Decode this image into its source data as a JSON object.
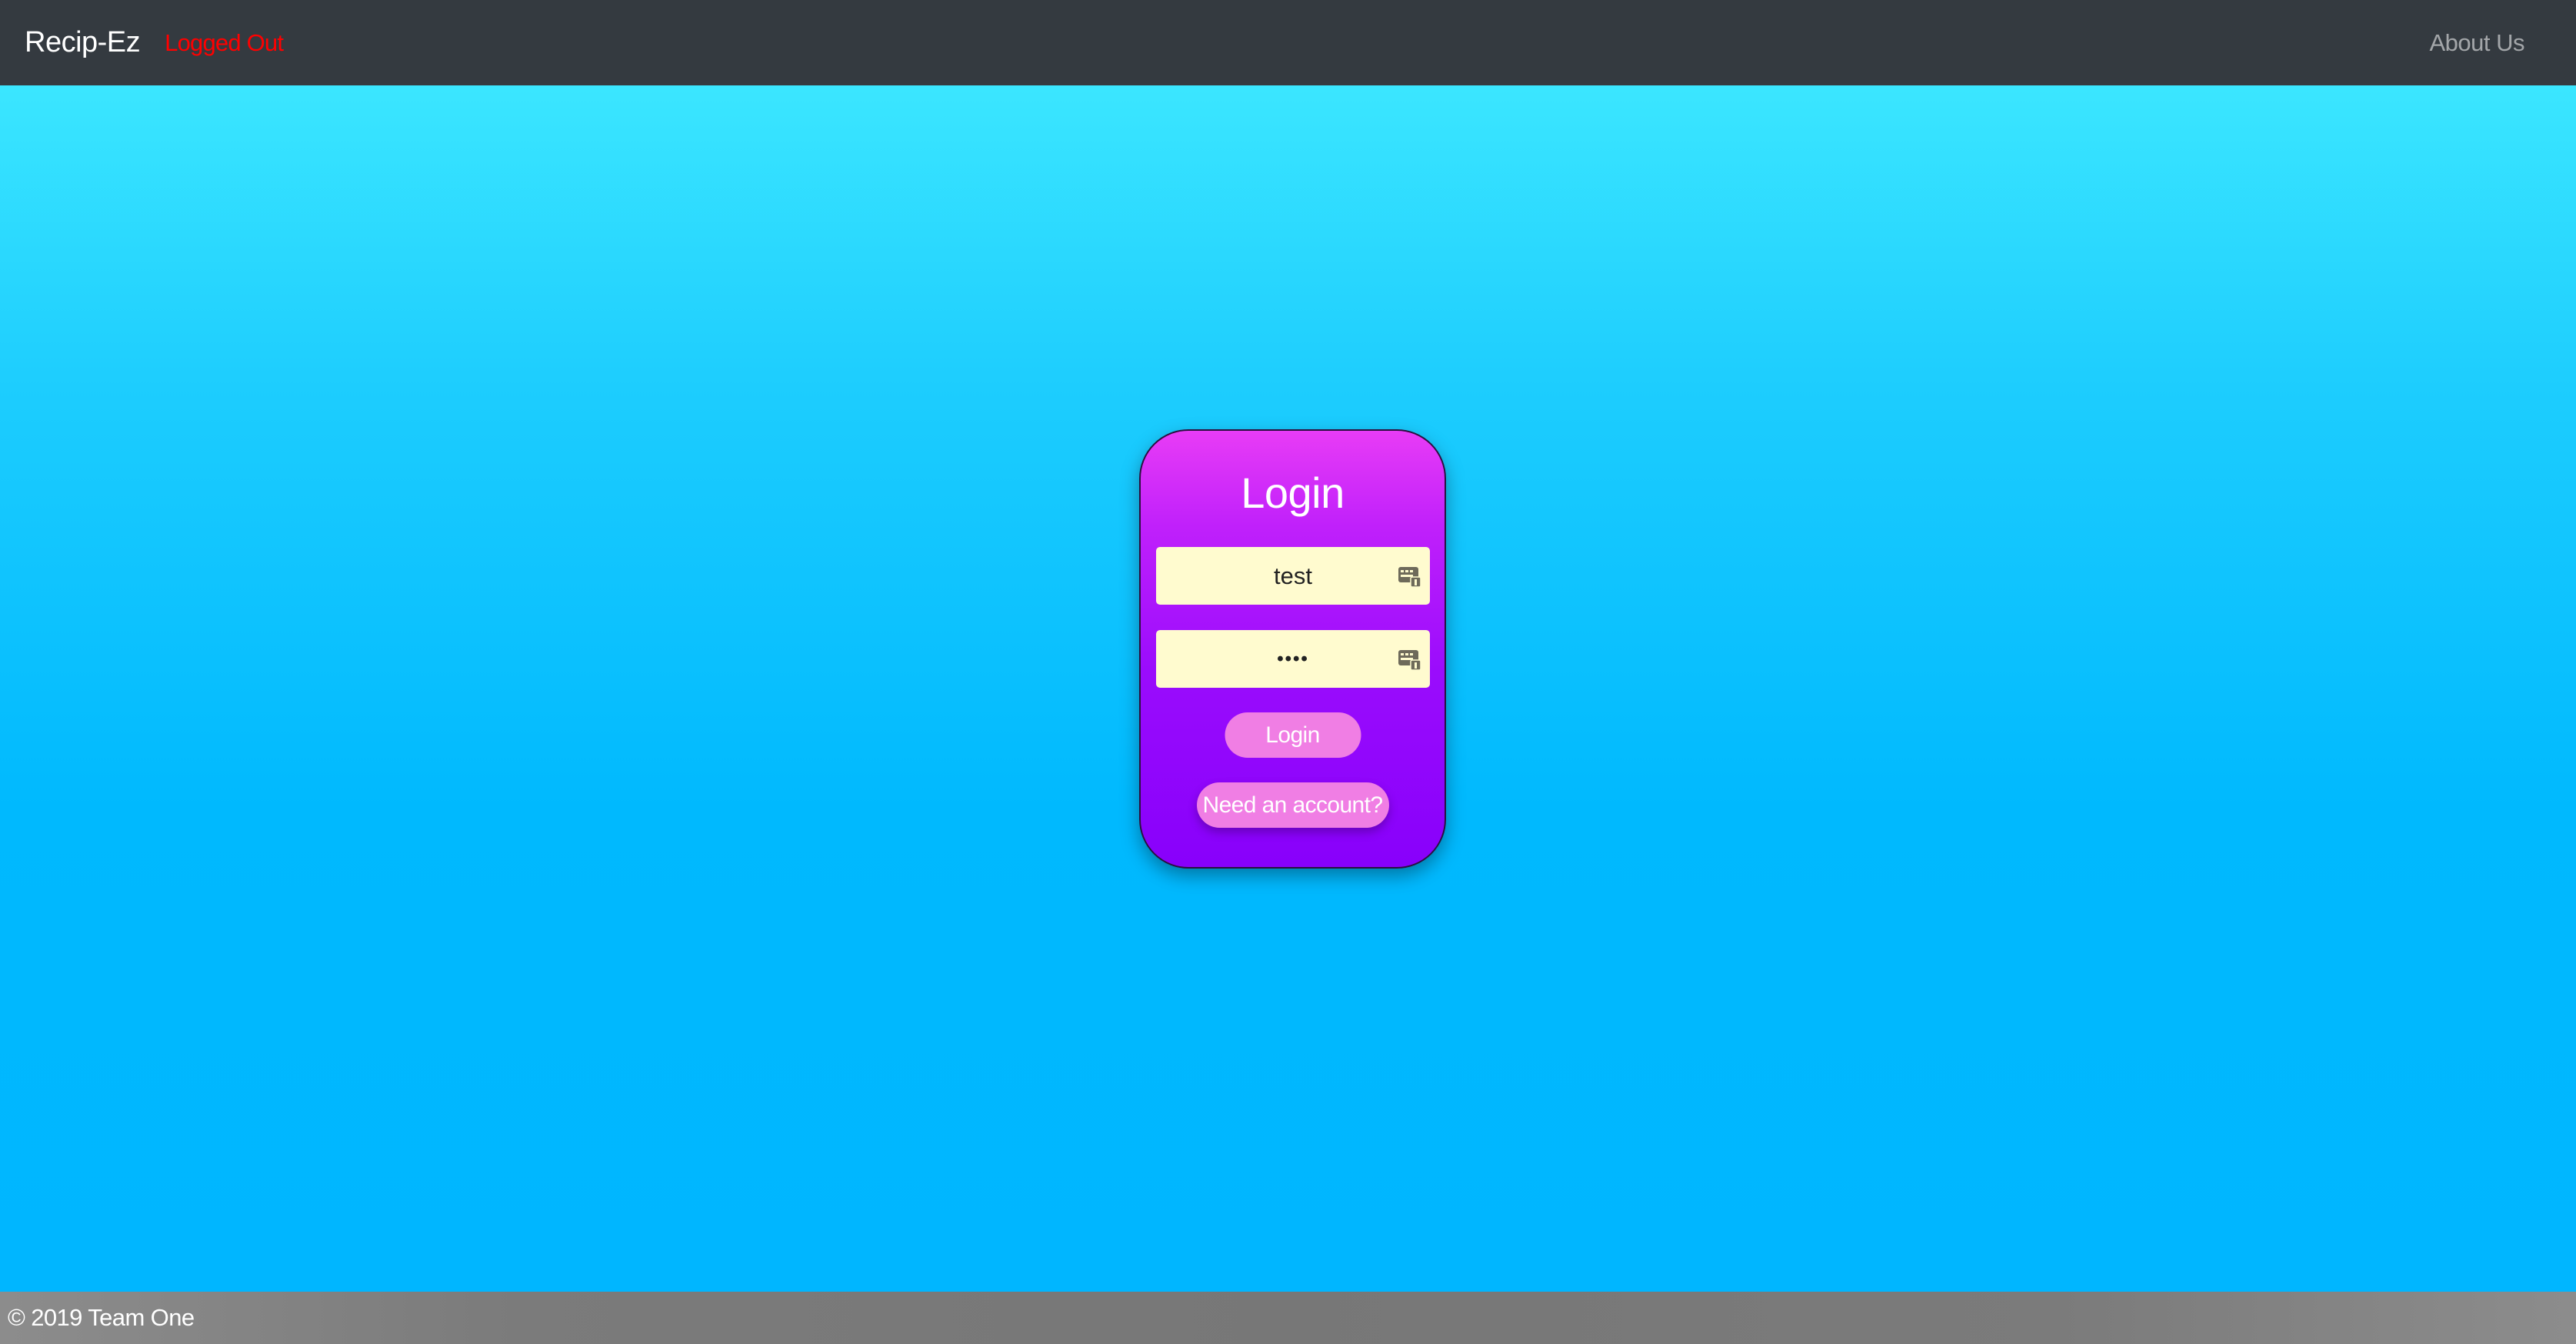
{
  "navbar": {
    "brand": "Recip-Ez",
    "status": "Logged Out",
    "about_link": "About Us"
  },
  "login_card": {
    "title": "Login",
    "username_value": "test",
    "password_value": "••••",
    "login_button": "Login",
    "signup_button": "Need an account?"
  },
  "footer": {
    "text": "© 2019 Team One"
  },
  "colors": {
    "navbar_bg": "#343a40",
    "status_text": "#ff0000",
    "card_top": "#e83cf6",
    "card_bottom": "#8800fb",
    "input_bg": "#fffbcf",
    "button_bg": "#f07ee4",
    "page_bg_top": "#3be6ff",
    "page_bg_bottom": "#00b6ff",
    "footer_bg": "#7b7b7b"
  },
  "icons": {
    "field_autofill": "password-manager-icon"
  }
}
